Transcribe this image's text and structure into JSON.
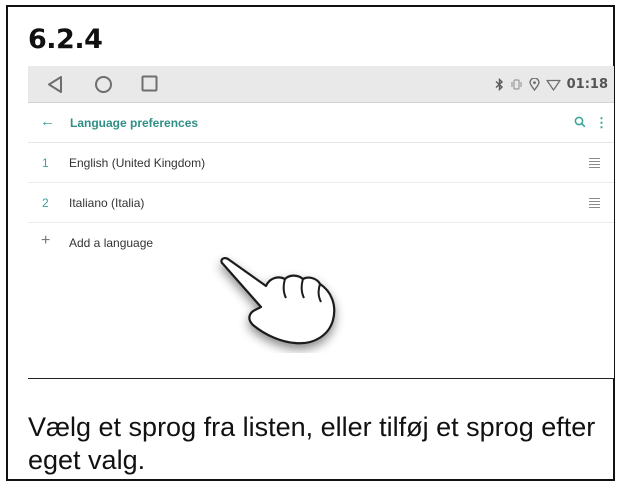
{
  "step_label": "6.2.4",
  "status_bar": {
    "nav": {
      "back": "back-icon",
      "home": "home-icon",
      "recents": "recents-icon"
    },
    "icons": [
      "bluetooth-icon",
      "vibrate-icon",
      "location-icon",
      "wifi-icon"
    ],
    "time": "01:18"
  },
  "app_bar": {
    "back_icon": "arrow-left-icon",
    "title": "Language preferences",
    "search_icon": "search-icon",
    "more_icon": "more-vertical-icon"
  },
  "languages": [
    {
      "index": "1",
      "name": "English (United Kingdom)"
    },
    {
      "index": "2",
      "name": "Italiano (Italia)"
    }
  ],
  "add_language": {
    "icon": "+",
    "label": "Add a language"
  },
  "caption": "Vælg et sprog fra listen, eller tilføj et sprog efter eget valg.",
  "colors": {
    "accent": "#3aa39a",
    "status_bar_bg": "#e9e9e9"
  }
}
